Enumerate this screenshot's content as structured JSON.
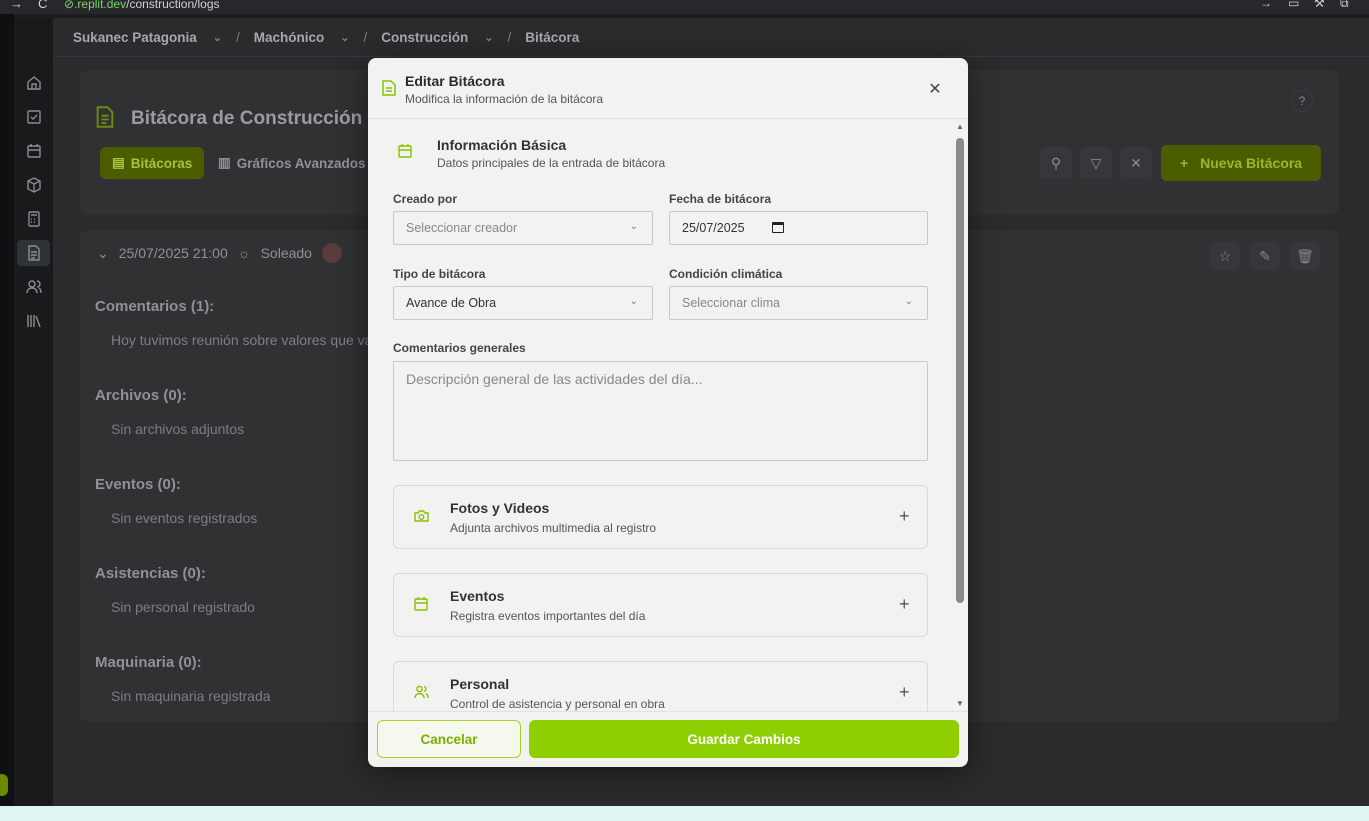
{
  "browser": {
    "url_prefix": ".",
    "url_domain": "replit.dev",
    "url_path": "/construction/logs"
  },
  "breadcrumb": {
    "items": [
      "Sukanec Patagonia",
      "Machónico",
      "Construcción",
      "Bitácora"
    ]
  },
  "page": {
    "title": "Bitácora de Construcción",
    "tabs": [
      "Bitácoras",
      "Gráficos Avanzados"
    ],
    "new_button": "Nueva Bitácora"
  },
  "entry": {
    "datetime": "25/07/2025 21:00",
    "weather": "Soleado"
  },
  "sections": [
    {
      "title": "Comentarios (1):",
      "text": "Hoy tuvimos reunión sobre valores que va"
    },
    {
      "title": "Archivos (0):",
      "text": "Sin archivos adjuntos"
    },
    {
      "title": "Eventos (0):",
      "text": "Sin eventos registrados"
    },
    {
      "title": "Asistencias (0):",
      "text": "Sin personal registrado"
    },
    {
      "title": "Maquinaria (0):",
      "text": "Sin maquinaria registrada"
    }
  ],
  "modal": {
    "title": "Editar Bitácora",
    "subtitle": "Modifica la información de la bitácora",
    "basic": {
      "title": "Información Básica",
      "subtitle": "Datos principales de la entrada de bitácora"
    },
    "fields": {
      "creado_por_label": "Creado por",
      "creado_por_placeholder": "Seleccionar creador",
      "fecha_label": "Fecha de bitácora",
      "fecha_value": "25/07/2025",
      "tipo_label": "Tipo de bitácora",
      "tipo_value": "Avance de Obra",
      "clima_label": "Condición climática",
      "clima_placeholder": "Seleccionar clima",
      "comentarios_label": "Comentarios generales",
      "comentarios_placeholder": "Descripción general de las actividades del día..."
    },
    "accordions": [
      {
        "title": "Fotos y Videos",
        "subtitle": "Adjunta archivos multimedia al registro",
        "icon": "camera-icon"
      },
      {
        "title": "Eventos",
        "subtitle": "Registra eventos importantes del día",
        "icon": "calendar-icon"
      },
      {
        "title": "Personal",
        "subtitle": "Control de asistencia y personal en obra",
        "icon": "users-icon"
      }
    ],
    "cancel_label": "Cancelar",
    "save_label": "Guardar Cambios"
  },
  "colors": {
    "accent": "#8fce00",
    "accent_icon": "#86c200",
    "modal_bg": "#f2f2f0",
    "overlay_bg": "#2a2b2d"
  }
}
